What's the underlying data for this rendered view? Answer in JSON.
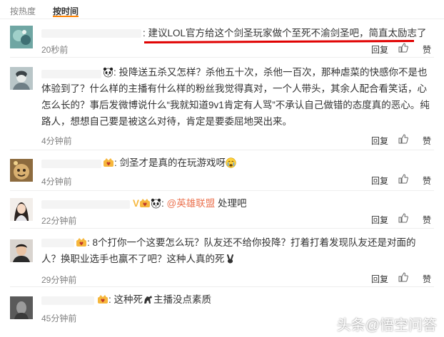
{
  "sort": {
    "hot_label": "按热度",
    "time_label": "按时间"
  },
  "comments": [
    {
      "text": ": 建议LOL官方给这个剑圣玩家做个至死不渝剑圣吧，简直太励志了",
      "time": "20秒前",
      "reply": "回复",
      "like": "赞"
    },
    {
      "text": ": 投降送五杀又怎样？杀他五十次，杀他一百次，那种虐菜的快感你不是也体验到了？什么样的主播有什么样的粉丝我觉得真对，一个人带头，其余人配合看笑话，心怎么长的？事后发微博说什么“我就知道9v1肯定有人骂”不承认自己做错的态度真的恶心。纯路人，想想自己要是被这么对待，肯定是要委屈地哭出来。",
      "time": "4分钟前",
      "reply": "回复",
      "like": "赞"
    },
    {
      "text": ": 剑圣才是真的在玩游戏呀",
      "time": "4分钟前",
      "reply": "回复",
      "like": "赞"
    },
    {
      "text_prefix": ":",
      "mention": "@英雄联盟",
      "text_suffix": "处理吧",
      "time": "22分钟前",
      "reply": "回复",
      "like": "赞"
    },
    {
      "text": ": 8个打你一个这要怎么玩？队友还不给你投降？打着打着发现队友还是对面的人？换职业选手也赢不了吧？这种人真的死",
      "time": "29分钟前",
      "reply": "回复",
      "like": "赞"
    },
    {
      "text": ": 这种死",
      "text_suffix": "主播没点素质",
      "time": "45分钟前",
      "reply": "回复",
      "like": "赞"
    }
  ],
  "watermark": "头条@悟空问答",
  "colors": {
    "accent": "#ff8200",
    "annotation": "#e00000",
    "mention": "#eb7350",
    "meta": "#808080"
  }
}
